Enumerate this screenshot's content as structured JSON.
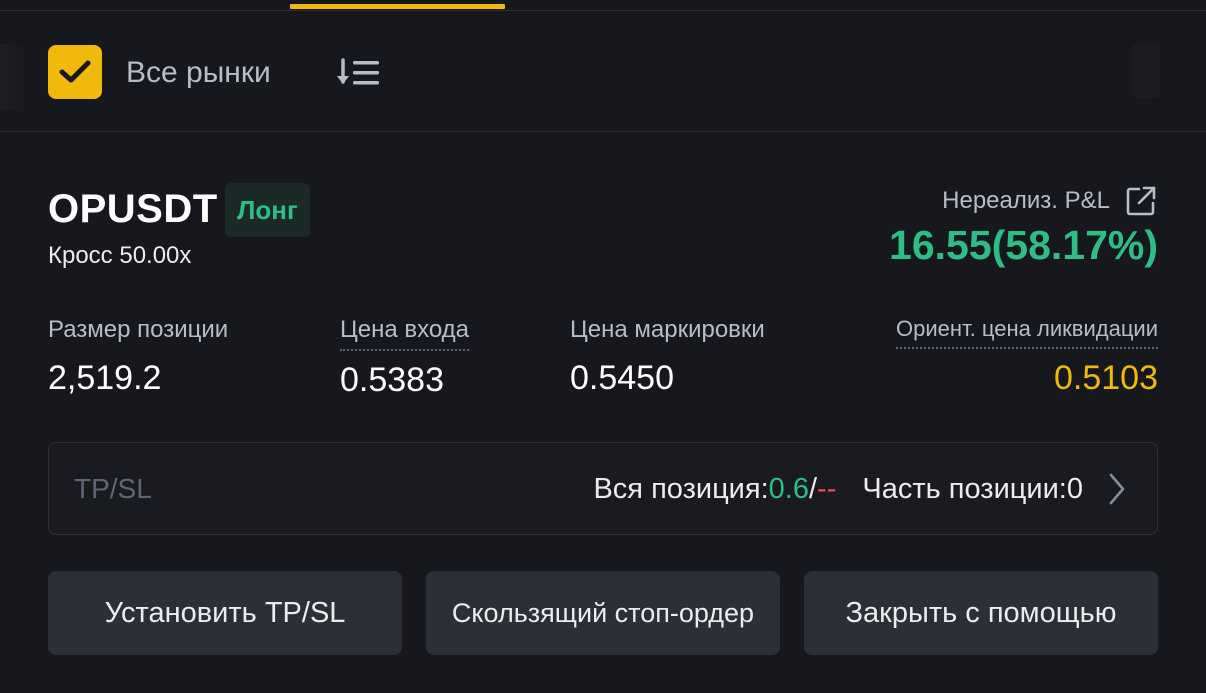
{
  "filter": {
    "all_markets_label": "Все рынки",
    "all_markets_checked": true
  },
  "position": {
    "symbol": "OPUSDT",
    "side": "Лонг",
    "margin_mode": "Кросс 50.00x",
    "pnl_label": "Нереализ. P&L",
    "pnl_value": "16.55(58.17%)",
    "stats": {
      "size_label": "Размер позиции",
      "size_value": "2,519.2",
      "entry_label": "Цена входа",
      "entry_value": "0.5383",
      "mark_label": "Цена маркировки",
      "mark_value": "0.5450",
      "liq_label": "Ориент. цена ликвидации",
      "liq_value": "0.5103"
    }
  },
  "tpsl": {
    "label": "TP/SL",
    "full_label": "Вся позиция: ",
    "full_tp": "0.6",
    "separator": "/",
    "full_sl": "--",
    "partial_label": "Часть позиции: ",
    "partial_value": "0"
  },
  "buttons": {
    "set_tpsl": "Установить TP/SL",
    "trailing_stop": "Скользящий стоп-ордер",
    "close_with": "Закрыть с помощью"
  },
  "colors": {
    "accent": "#f0b90b",
    "profit": "#2ebd85",
    "loss": "#f6465d",
    "background": "#17181e"
  },
  "icons": {
    "checkbox": "check-icon",
    "sort": "sort-icon",
    "share": "share-icon",
    "chevron": "chevron-right-icon"
  }
}
